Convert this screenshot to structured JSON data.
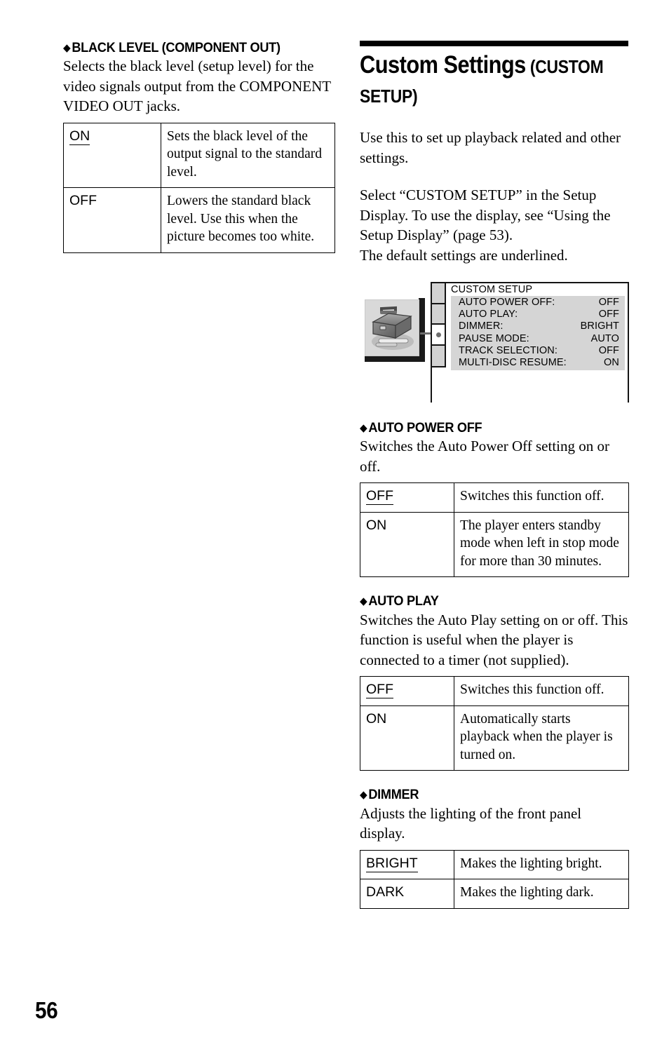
{
  "page": {
    "folio": "56"
  },
  "left_column": {
    "section": {
      "bullet": "◆",
      "heading": "BLACK LEVEL (COMPONENT OUT)",
      "paragraph": "Selects the black level (setup level) for the video signals output from the COMPONENT VIDEO OUT jacks.",
      "table": {
        "rows": [
          {
            "option": "ON",
            "underlined": true,
            "description": "Sets the black level of the output signal to the standard level."
          },
          {
            "option": "OFF",
            "underlined": false,
            "description": "Lowers the standard black level. Use this when the picture becomes too white."
          }
        ]
      }
    }
  },
  "right_column": {
    "chapter": {
      "title_main": "Custom Settings",
      "title_small": " (CUSTOM SETUP)"
    },
    "intro": {
      "paragraph_1": "Use this to set up playback related and other settings.",
      "paragraph_2": "Select “CUSTOM SETUP” in the Setup Display. To use the display, see “Using the Setup Display” (page 53).",
      "paragraph_3": "The default settings are underlined."
    },
    "osd": {
      "icon_name": "toolbox-icon",
      "sidebar_cells": [
        {
          "selected": false
        },
        {
          "selected": false
        },
        {
          "selected": true
        },
        {
          "selected": false
        }
      ],
      "title": "CUSTOM SETUP",
      "items": [
        {
          "label": "AUTO POWER OFF:",
          "value": "OFF"
        },
        {
          "label": "AUTO PLAY:",
          "value": "OFF"
        },
        {
          "label": "DIMMER:",
          "value": "BRIGHT"
        },
        {
          "label": "PAUSE MODE:",
          "value": "AUTO"
        },
        {
          "label": "TRACK SELECTION:",
          "value": "OFF"
        },
        {
          "label": "MULTI-DISC RESUME:",
          "value": "ON"
        }
      ]
    },
    "sections": [
      {
        "bullet": "◆",
        "heading": "AUTO POWER OFF",
        "paragraph": "Switches the Auto Power Off setting on or off.",
        "table": {
          "rows": [
            {
              "option": "OFF",
              "underlined": true,
              "description": "Switches this function off."
            },
            {
              "option": "ON",
              "underlined": false,
              "description": "The player enters standby mode when left in stop mode for more than 30 minutes."
            }
          ]
        }
      },
      {
        "bullet": "◆",
        "heading": "AUTO PLAY",
        "paragraph": "Switches the Auto Play setting on or off. This function is useful when the player is connected to a timer (not supplied).",
        "table": {
          "rows": [
            {
              "option": "OFF",
              "underlined": true,
              "description": "Switches this function off."
            },
            {
              "option": "ON",
              "underlined": false,
              "description": "Automatically starts playback when the player is turned on."
            }
          ]
        }
      },
      {
        "bullet": "◆",
        "heading": "DIMMER",
        "paragraph": "Adjusts the lighting of the front panel display.",
        "table": {
          "rows": [
            {
              "option": "BRIGHT",
              "underlined": true,
              "description": "Makes the lighting bright."
            },
            {
              "option": "DARK",
              "underlined": false,
              "description": "Makes the lighting dark."
            }
          ]
        }
      }
    ]
  }
}
